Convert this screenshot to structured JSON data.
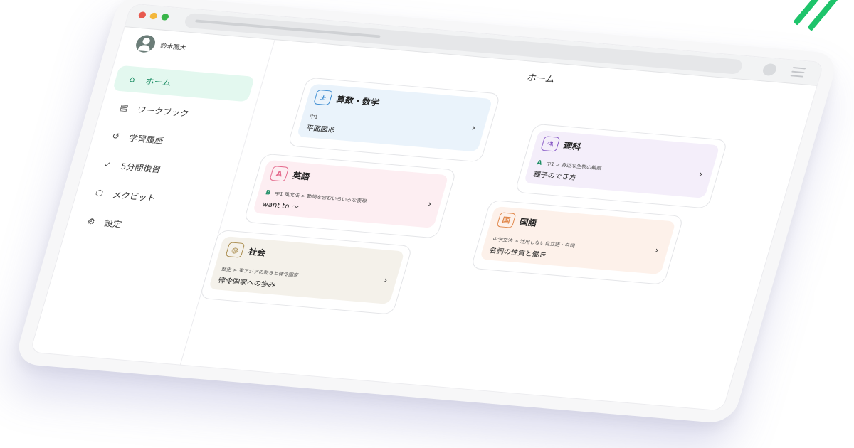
{
  "window": {
    "dots": [
      "#e8594f",
      "#f3b73b",
      "#39b54a"
    ],
    "accent": "#1ec46b"
  },
  "user": {
    "name": "鈴木陽大"
  },
  "nav": {
    "items": [
      {
        "id": "home",
        "label": "ホーム",
        "icon": "home-icon",
        "glyph": "⌂",
        "active": true
      },
      {
        "id": "workbook",
        "label": "ワークブック",
        "icon": "book-icon",
        "glyph": "▤",
        "active": false
      },
      {
        "id": "history",
        "label": "学習履歴",
        "icon": "history-icon",
        "glyph": "↺",
        "active": false
      },
      {
        "id": "review",
        "label": "5分間復習",
        "icon": "check-circle-icon",
        "glyph": "✓",
        "active": false
      },
      {
        "id": "mecubit",
        "label": "メクビット",
        "icon": "cube-icon",
        "glyph": "⬡",
        "active": false
      },
      {
        "id": "settings",
        "label": "設定",
        "icon": "gear-icon",
        "glyph": "⚙",
        "active": false
      }
    ]
  },
  "main": {
    "title": "ホーム",
    "cards": [
      {
        "subject": "算数・数学",
        "icon": "math-icon",
        "glyph": "±",
        "tint": "#eaf3fb",
        "icon_color": "#3a8bd1",
        "badge": "",
        "badge_color": "",
        "crumb": "中1",
        "topic": "平面図形"
      },
      {
        "subject": "理科",
        "icon": "flask-icon",
        "glyph": "⚗",
        "tint": "#f4eefa",
        "icon_color": "#8a5cc7",
        "badge": "A",
        "badge_color": "#1f8f66",
        "crumb": "中1 > 身近な生物の観察",
        "topic": "種子のでき方"
      },
      {
        "subject": "英語",
        "icon": "abc-icon",
        "glyph": "A",
        "tint": "#fdeef2",
        "icon_color": "#e46a8c",
        "badge": "B",
        "badge_color": "#1f8f66",
        "crumb": "中1 英文法 > 動詞を含むいろいろな表現",
        "topic": "want to ～"
      },
      {
        "subject": "国語",
        "icon": "notebook-icon",
        "glyph": "国",
        "tint": "#fdf1ea",
        "icon_color": "#e0874a",
        "badge": "",
        "badge_color": "",
        "crumb": "中学文法 > 活用しない自立語・名詞",
        "topic": "名詞の性質と働き"
      },
      {
        "subject": "社会",
        "icon": "globe-icon",
        "glyph": "◍",
        "tint": "#f4f1ea",
        "icon_color": "#a88a4a",
        "badge": "",
        "badge_color": "",
        "crumb": "歴史 > 東アジアの動きと律令国家",
        "topic": "律令国家への歩み"
      }
    ]
  }
}
